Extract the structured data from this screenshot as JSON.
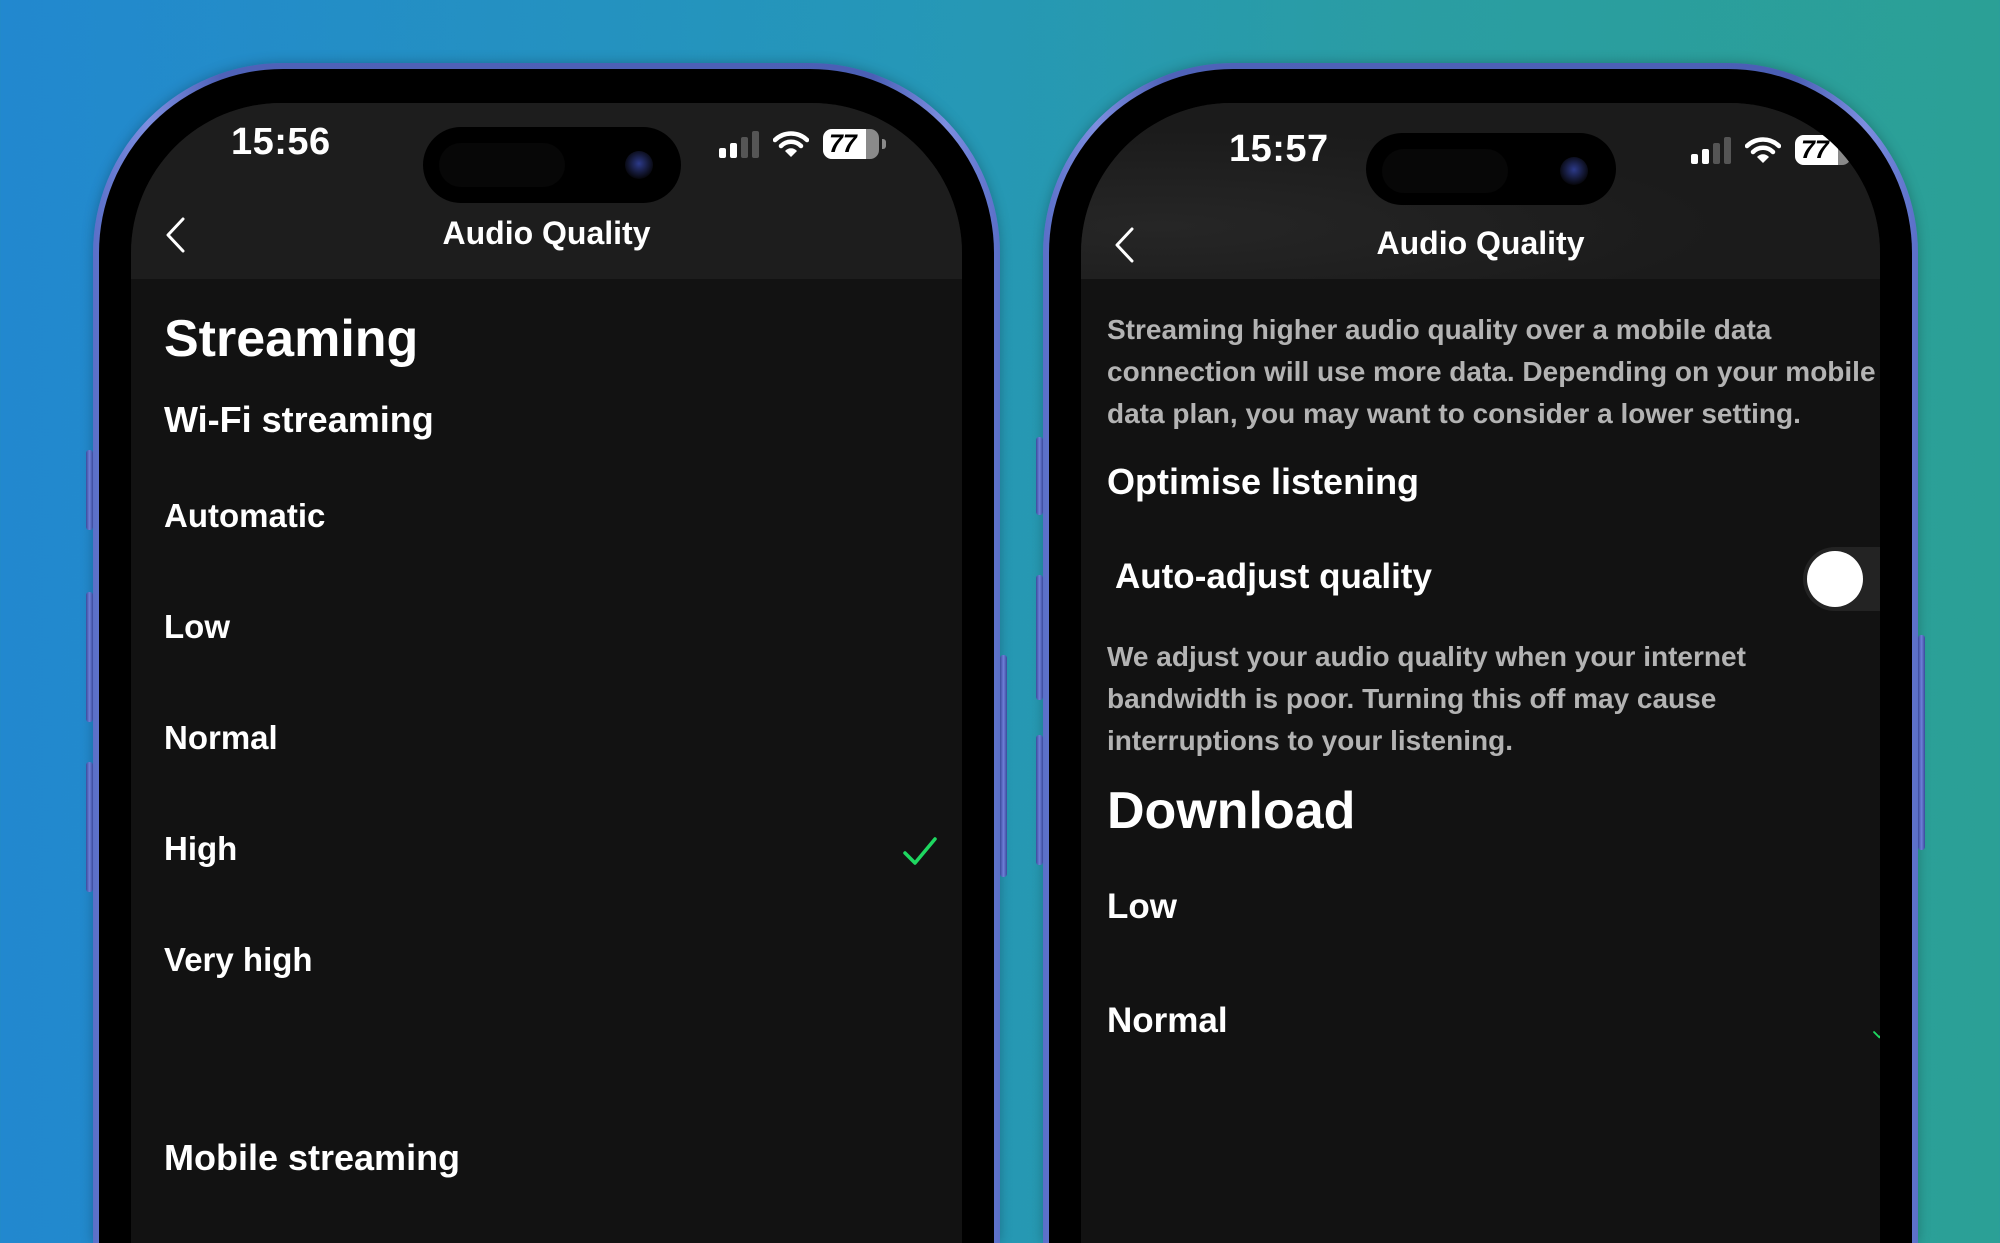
{
  "theme": {
    "accent_green": "#1ed760",
    "screen_bg": "#121212",
    "header_bg": "#1d1d1d",
    "secondary_text": "#b3b3b3"
  },
  "left_phone": {
    "status": {
      "time": "15:56",
      "signal_bars_active": 2,
      "signal_bars_total": 4,
      "wifi": "wifi-icon",
      "battery_percent": "77"
    },
    "nav": {
      "back_icon": "chevron-left-icon",
      "title": "Audio Quality"
    },
    "section_title": "Streaming",
    "subsection_title": "Wi-Fi streaming",
    "wifi_options": [
      {
        "label": "Automatic",
        "selected": false
      },
      {
        "label": "Low",
        "selected": false
      },
      {
        "label": "Normal",
        "selected": false
      },
      {
        "label": "High",
        "selected": true
      },
      {
        "label": "Very high",
        "selected": false
      }
    ],
    "next_subsection_title": "Mobile streaming"
  },
  "right_phone": {
    "status": {
      "time": "15:57",
      "signal_bars_active": 2,
      "signal_bars_total": 4,
      "wifi": "wifi-icon",
      "battery_percent": "77"
    },
    "nav": {
      "back_icon": "chevron-left-icon",
      "title": "Audio Quality"
    },
    "mobile_data_note": [
      "Streaming higher audio quality over a mobile data",
      "connection will use more data. Depending on your mobile",
      "data plan, you may want to consider a lower setting."
    ],
    "optimise_title": "Optimise listening",
    "auto_adjust": {
      "label": "Auto-adjust quality",
      "enabled": false
    },
    "auto_adjust_note": [
      "We adjust your audio quality when your internet",
      "bandwidth is poor. Turning this off may cause",
      "interruptions to your listening."
    ],
    "download_title": "Download",
    "download_options": [
      {
        "label": "Low",
        "selected": false
      },
      {
        "label": "Normal",
        "selected": true
      }
    ]
  }
}
